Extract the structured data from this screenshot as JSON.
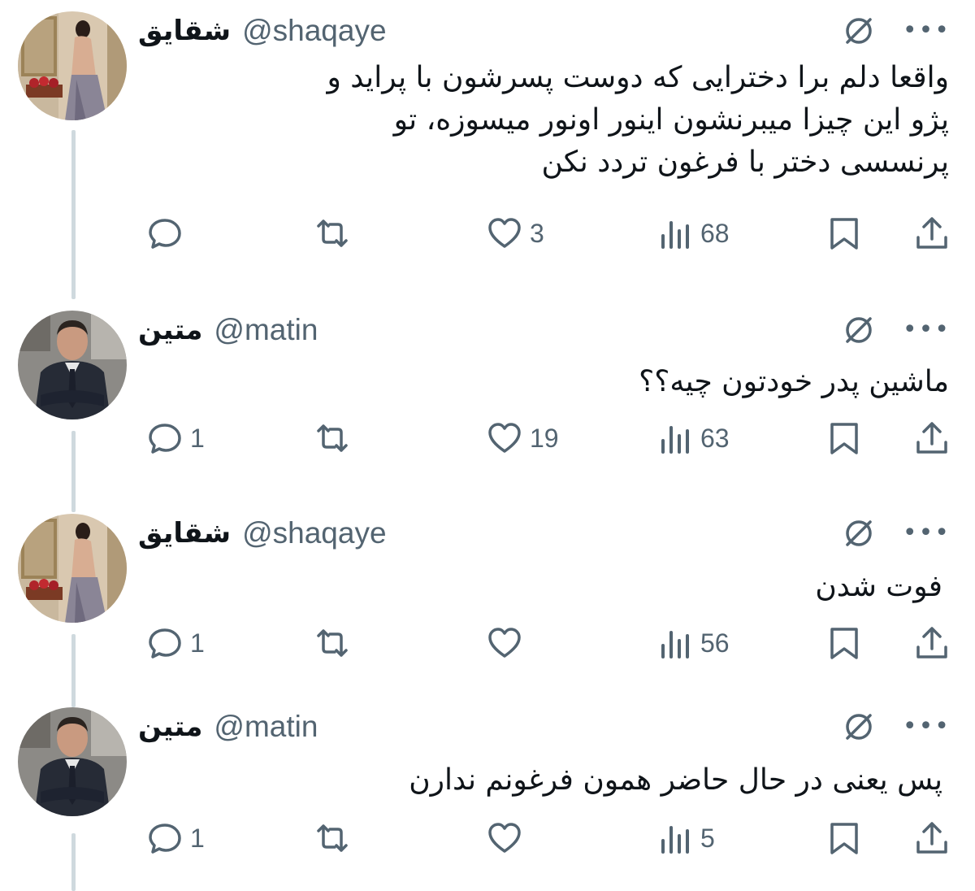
{
  "tweets": [
    {
      "name": "شقایق",
      "handle": "@shaqaye",
      "text": "واقعا دلم برا دخترایی که دوست پسرشون  با پراید و\nپژو این چیزا میبرنشون اینور اونور میسوزه، تو\nپرنسسی دختر با فرغون تردد نکن",
      "avatar_icon": "woman-in-gown-avatar",
      "replies": "",
      "retweets": "",
      "likes": "3",
      "views": "68"
    },
    {
      "name": "متین",
      "handle": "@matin",
      "text": "ماشین پدر خودتون چیه؟؟",
      "avatar_icon": "man-in-suit-avatar",
      "replies": "1",
      "retweets": "",
      "likes": "19",
      "views": "63"
    },
    {
      "name": "شقایق",
      "handle": "@shaqaye",
      "text": "فوت شدن",
      "avatar_icon": "woman-in-gown-avatar",
      "replies": "1",
      "retweets": "",
      "likes": "",
      "views": "56"
    },
    {
      "name": "متین",
      "handle": "@matin",
      "text": "پس یعنی در حال حاضر همون فرغونم ندارن",
      "avatar_icon": "man-in-suit-avatar",
      "replies": "1",
      "retweets": "",
      "likes": "",
      "views": "5"
    }
  ],
  "icons": {
    "grok": "grok-icon",
    "more": "•••",
    "reply": "reply-icon",
    "retweet": "retweet-icon",
    "like": "heart-icon",
    "views": "views-icon",
    "bookmark": "bookmark-icon",
    "share": "share-icon"
  },
  "colors": {
    "text": "#0f1419",
    "secondary": "#536471",
    "thread_line": "#cfd9de"
  }
}
